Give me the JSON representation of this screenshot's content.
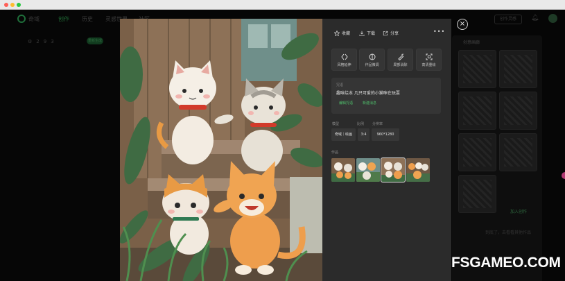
{
  "app": {
    "logo_text": "奇域",
    "nav": [
      "创作",
      "历史",
      "灵感世界",
      "社区"
    ],
    "right_button": "创作灵感",
    "params_strip": [
      "2",
      "9",
      "3",
      "重新生成"
    ]
  },
  "side_panel": {
    "title": "创意画廊",
    "action": "加入创作",
    "footer": "到底了，去看看其他作品"
  },
  "modal": {
    "close_label": "×",
    "toolbar": {
      "favorite": "收藏",
      "download": "下载",
      "share": "分享",
      "more": "•••"
    },
    "tools": [
      "风格延伸",
      "作品微调",
      "局部消除",
      "高清重绘"
    ],
    "prompt": {
      "heading": "咒语",
      "text": "趣味绘本 几只可爱的小猫咪在玩耍",
      "edit_link": "编辑咒语",
      "new_link": "新建消息"
    },
    "params": {
      "labels": [
        "模型",
        "比例",
        "分辨率"
      ],
      "model": "奇域｜绘画",
      "ratio": "3:4",
      "resolution": "960*1280"
    },
    "works_heading": "作品",
    "selected_work": 3
  },
  "watermark": "FSGAMEO.COM",
  "colors": {
    "accent_green": "#4fbf6b",
    "panel_bg": "#2b2b2b",
    "tool_bg": "#353535"
  }
}
